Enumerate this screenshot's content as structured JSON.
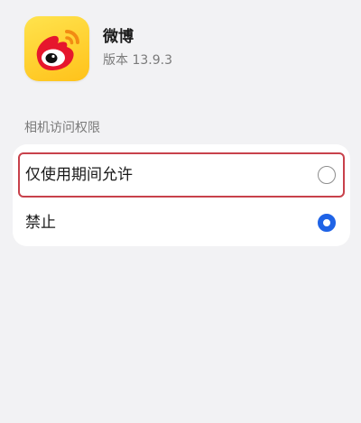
{
  "app": {
    "name": "微博",
    "version": "版本 13.9.3",
    "icon": "weibo-logo-icon"
  },
  "permission": {
    "section_title": "相机访问权限",
    "options": [
      {
        "label": "仅使用期间允许",
        "selected": false
      },
      {
        "label": "禁止",
        "selected": true
      }
    ]
  },
  "colors": {
    "accent": "#1f63e6",
    "highlight_border": "#c8414b",
    "icon_background": "#ffc21a",
    "logo_red": "#e6162d",
    "page_background": "#f2f2f4"
  }
}
